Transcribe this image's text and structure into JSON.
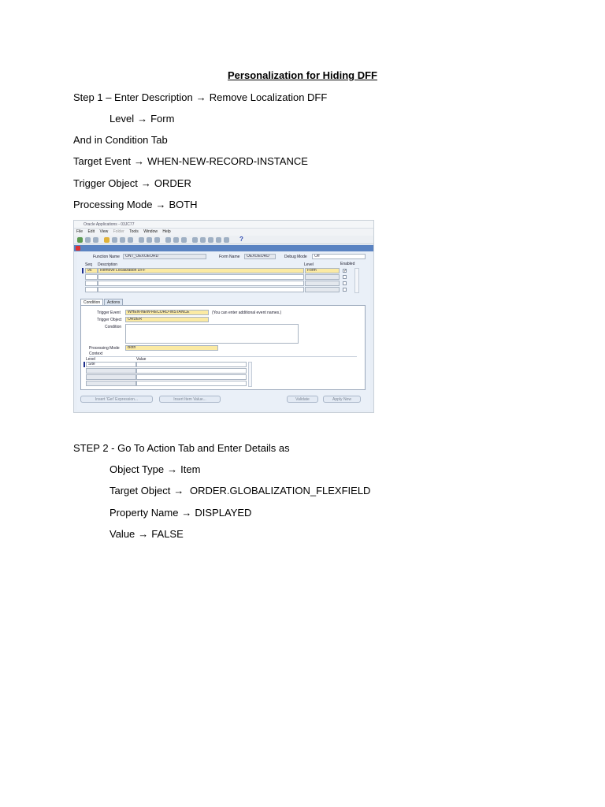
{
  "doc": {
    "title": "Personalization for Hiding DFF",
    "arrow": "→",
    "step1": {
      "label": "Step 1 – Enter Description",
      "value": "Remove Localization DFF"
    },
    "level": {
      "label": "Level",
      "value": "Form"
    },
    "condition_tab": "And in Condition Tab",
    "target_event": {
      "label": "Target Event",
      "value": "WHEN-NEW-RECORD-INSTANCE"
    },
    "trigger_object": {
      "label": "Trigger Object",
      "value": "ORDER"
    },
    "processing_mode": {
      "label": "Processing Mode",
      "value": "BOTH"
    },
    "step2": "STEP 2  -  Go To Action Tab  and Enter Details as",
    "object_type": {
      "label": "Object Type",
      "value": "Item"
    },
    "target_object": {
      "label": "Target Object",
      "value": "ORDER.GLOBALIZATION_FLEXFIELD"
    },
    "property_name": {
      "label": "Property Name",
      "value": "DISPLAYED"
    },
    "value": {
      "label": "Value",
      "value": "FALSE"
    }
  },
  "screenshot": {
    "window_title": "Oracle Applications - 03JC77",
    "menu": [
      "File",
      "Edit",
      "View",
      "Folder",
      "Tools",
      "Window",
      "Help"
    ],
    "function_name_label": "Function Name",
    "function_name_value": "ONT_OEXOEORD",
    "form_name_label": "Form Name",
    "form_name_value": "OEXOEORD",
    "debug_mode_label": "Debug Mode",
    "debug_mode_value": "Off",
    "col_seq": "Seq",
    "col_description": "Description",
    "col_level": "Level",
    "col_enabled": "Enabled",
    "row1_seq": "96",
    "row1_description": "Remove Localization DFF",
    "row1_level": "Form",
    "tab_condition": "Condition",
    "tab_actions": "Actions",
    "trigger_event_label": "Trigger Event",
    "trigger_event_value": "WHEN-NEW-RECORD-INSTANCE",
    "hint": "(You can enter additional event names.)",
    "trigger_object_label": "Trigger Object",
    "trigger_object_value": "ORDER",
    "condition_label": "Condition",
    "processing_mode_label": "Processing Mode",
    "processing_mode_value": "Both",
    "context_label": "Context",
    "ctx_level_label": "Level",
    "ctx_value_label": "Value",
    "ctx_level_value": "Site",
    "btn_insert_expression": "Insert 'Get' Expression...",
    "btn_insert_item_value": "Insert Item Value...",
    "btn_validate": "Validate",
    "btn_apply_now": "Apply Now"
  }
}
